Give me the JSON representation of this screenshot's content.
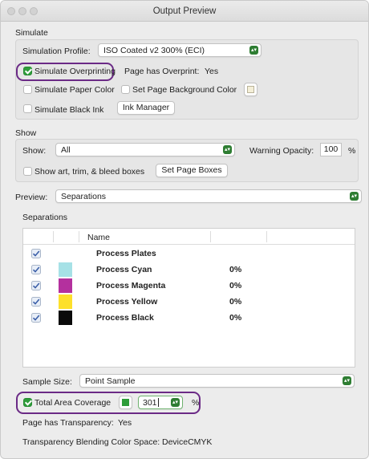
{
  "window": {
    "title": "Output Preview"
  },
  "simulate": {
    "section_label": "Simulate",
    "profile_label": "Simulation Profile:",
    "profile_value": "ISO Coated v2 300% (ECI)",
    "overprinting_label": "Simulate Overprinting",
    "overprinting_checked": true,
    "page_overprint_label": "Page has Overprint:",
    "page_overprint_value": "Yes",
    "paper_color_label": "Simulate Paper Color",
    "page_bg_label": "Set Page Background Color",
    "black_ink_label": "Simulate Black Ink",
    "ink_manager_label": "Ink Manager"
  },
  "show": {
    "section_label": "Show",
    "show_label": "Show:",
    "show_value": "All",
    "warning_label": "Warning Opacity:",
    "warning_value": "100",
    "warning_unit": "%",
    "boxes_label": "Show art, trim, & bleed boxes",
    "set_boxes_label": "Set Page Boxes"
  },
  "preview": {
    "label": "Preview:",
    "value": "Separations"
  },
  "separations": {
    "section_label": "Separations",
    "column_name": "Name",
    "rows": [
      {
        "name": "Process Plates",
        "pct": "",
        "color": "",
        "visible": true
      },
      {
        "name": "Process Cyan",
        "pct": "0%",
        "color": "#a6e1e6",
        "visible": true
      },
      {
        "name": "Process Magenta",
        "pct": "0%",
        "color": "#b4309e",
        "visible": true
      },
      {
        "name": "Process Yellow",
        "pct": "0%",
        "color": "#fde02b",
        "visible": true
      },
      {
        "name": "Process Black",
        "pct": "0%",
        "color": "#0a0a0a",
        "visible": true
      }
    ]
  },
  "sample": {
    "label": "Sample Size:",
    "value": "Point Sample"
  },
  "coverage": {
    "label": "Total Area Coverage",
    "checked": true,
    "swatch_color": "#2e9d3a",
    "value": "301",
    "unit": "%"
  },
  "info": {
    "transparency_label": "Page has Transparency:",
    "transparency_value": "Yes",
    "blending_label": "Transparency Blending Color Space:",
    "blending_value": "DeviceCMYK"
  },
  "colors": {
    "highlight": "#6b2a86",
    "check_green": "#2e9d3a"
  }
}
